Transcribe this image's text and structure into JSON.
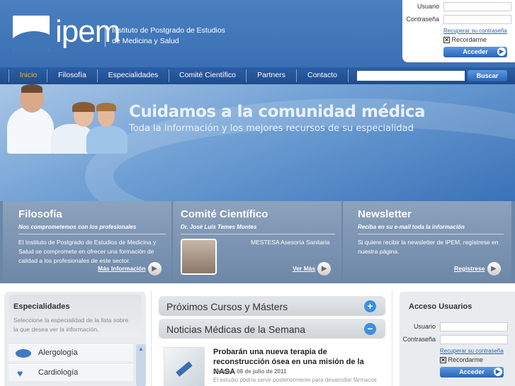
{
  "header": {
    "logo_word": "ipem",
    "logo_line1": "Instituto de Postgrado de Estudios",
    "logo_line2": "de Medicina y Salud"
  },
  "login": {
    "user_label": "Usuario",
    "pass_label": "Contraseña",
    "recover_link": "Recuperar su contraseña",
    "remember_label": "Recordarme",
    "submit_label": "Acceder"
  },
  "nav": {
    "items": [
      "Inicio",
      "Filosofía",
      "Especialidades",
      "Comité Científico",
      "Partners",
      "Contacto"
    ],
    "search_button": "Buscar"
  },
  "banner": {
    "title": "Cuidamos a la comunidad médica",
    "subtitle": "Toda la información y los mejores recursos de su especialidad"
  },
  "panels": {
    "filosofia": {
      "title": "Filosofía",
      "subtitle": "Nos comprometemos con los profesionales",
      "text": "El Instituto de Postgrado de Estudios de Medicina y Salud se compromete en ofrecer una formación de calidad a los profesionales de este sector.",
      "link": "Más Información"
    },
    "comite": {
      "title": "Comité Científico",
      "subtitle": "Dr. José Luis Temes Montes",
      "text": "MESTESA Asesoría Sanitaria",
      "link": "Ver Más"
    },
    "newsletter": {
      "title": "Newsletter",
      "subtitle": "Reciba en su e-mail toda la información",
      "text": "Si quiere recibir la newsletter de IPEM, regístrese en nuestra página.",
      "link": "Regístrese"
    }
  },
  "especialidades": {
    "title": "Especialidades",
    "description": "Seleccione la especialidad de la lista sobre la que desea ver la información.",
    "items": [
      "Alergología",
      "Cardiología"
    ]
  },
  "cursos": {
    "title": "Próximos Cursos y Másters",
    "toggle": "+"
  },
  "noticias": {
    "title": "Noticias Médicas de la Semana",
    "toggle": "−",
    "item": {
      "headline": "Probarán una nueva terapia de reconstrucción ósea en una misión de la NASA",
      "date": "Viernes, 08 de julio de 2011",
      "excerpt": "El estudio podría servir posteriormente para desarrollar fármacos"
    }
  },
  "acceso": {
    "title": "Acceso Usuarios",
    "user_label": "Usuario",
    "pass_label": "Contraseña",
    "recover_link": "Recuperar su contraseña",
    "remember_label": "Recordarme",
    "submit_label": "Acceder"
  },
  "colors": {
    "header_blue": "#3a70b3",
    "nav_blue": "#1f4c8c",
    "active_nav": "#f2b21a",
    "link_blue": "#2a5fa8",
    "accent_plus": "#3d8fe0"
  }
}
